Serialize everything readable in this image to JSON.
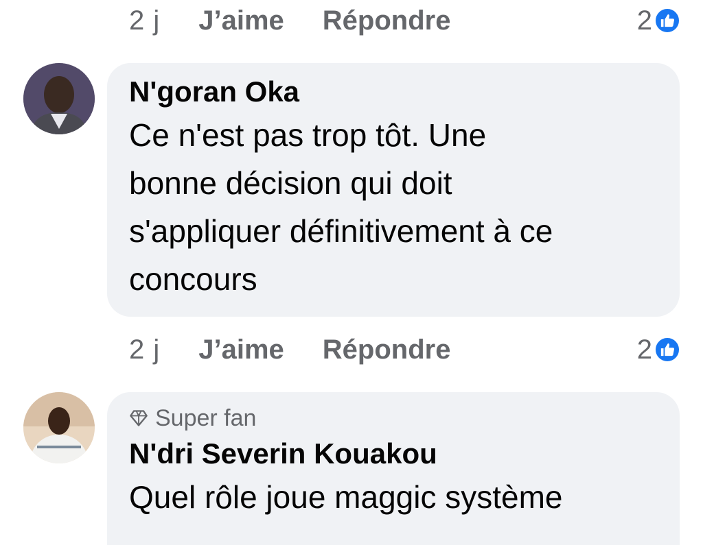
{
  "colors": {
    "bubble_bg": "#f0f2f5",
    "meta_text": "#65676b",
    "like_blue": "#1877f2",
    "name_text": "#050505"
  },
  "top_actions": {
    "time": "2 j",
    "like_label": "J’aime",
    "reply_label": "Répondre",
    "reaction_count": "2",
    "reaction_icon": "thumbs-up-icon"
  },
  "comments": [
    {
      "author": "N'goran Oka",
      "lines": [
        "Ce n'est pas trop tôt. Une",
        "bonne décision qui doit",
        "s'appliquer définitivement à ce",
        "concours"
      ],
      "actions": {
        "time": "2 j",
        "like_label": "J’aime",
        "reply_label": "Répondre",
        "reaction_count": "2",
        "reaction_icon": "thumbs-up-icon"
      }
    },
    {
      "badge": "Super fan",
      "badge_icon": "diamond-icon",
      "author": "N'dri Severin Kouakou",
      "lines": [
        "Quel rôle joue maggic système"
      ]
    }
  ]
}
